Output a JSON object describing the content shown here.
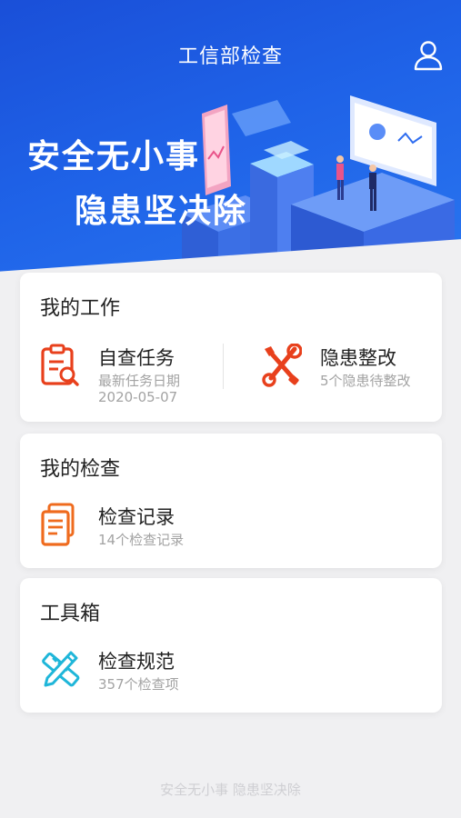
{
  "header": {
    "title": "工信部检查",
    "user_icon": "user-icon"
  },
  "banner": {
    "slogan_line1": "安全无小事",
    "slogan_line2": "隐患坚决除"
  },
  "my_work": {
    "title": "我的工作",
    "items": [
      {
        "name": "自查任务",
        "sub1": "最新任务日期",
        "sub2": "2020-05-07",
        "icon": "clipboard-search-icon",
        "color": "#e8401c"
      },
      {
        "name": "隐患整改",
        "sub1": "5个隐患待整改",
        "icon": "wrench-screwdriver-icon",
        "color": "#e8401c"
      }
    ]
  },
  "my_inspection": {
    "title": "我的检查",
    "items": [
      {
        "name": "检查记录",
        "sub1": "14个检查记录",
        "icon": "documents-icon",
        "color": "#ef6b1e"
      }
    ]
  },
  "toolbox": {
    "title": "工具箱",
    "items": [
      {
        "name": "检查规范",
        "sub1": "357个检查项",
        "icon": "ruler-pencil-icon",
        "color": "#1fb6d9"
      }
    ]
  },
  "footer": {
    "text": "安全无小事 隐患坚决除"
  },
  "colors": {
    "hero": "#1f63e8",
    "background": "#f0f0f2",
    "accent_red": "#e8401c",
    "accent_orange": "#ef6b1e",
    "accent_cyan": "#1fb6d9"
  }
}
